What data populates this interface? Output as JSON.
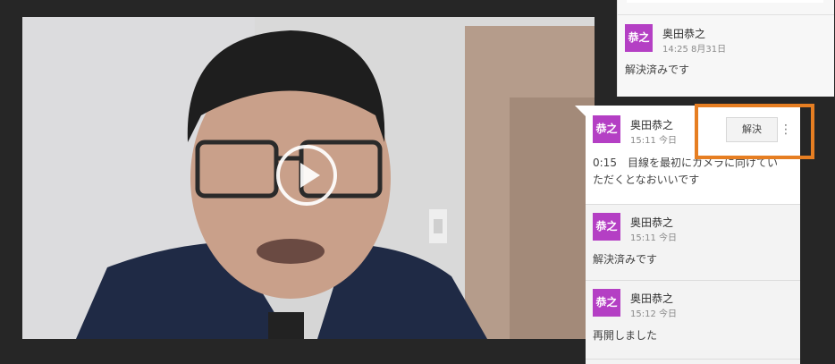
{
  "video": {
    "play_icon": "play-icon"
  },
  "comments_top": {
    "avatar_text": "恭之",
    "author": "奥田恭之",
    "timestamp": "14:25 8月31日",
    "body": "解決済みです"
  },
  "thread": {
    "comments": [
      {
        "avatar_text": "恭之",
        "author": "奥田恭之",
        "timestamp": "15:11 今日",
        "body_line1": "0:15　目線を最初にカメラに向けてい",
        "body_line2": "ただくとなおいいです"
      },
      {
        "avatar_text": "恭之",
        "author": "奥田恭之",
        "timestamp": "15:11 今日",
        "body": "解決済みです"
      },
      {
        "avatar_text": "恭之",
        "author": "奥田恭之",
        "timestamp": "15:12 今日",
        "body": "再開しました"
      }
    ],
    "resolve_label": "解決",
    "more_icon": "⋮"
  },
  "colors": {
    "avatar": "#b43fc4",
    "highlight": "#e67e22",
    "background": "#262626"
  }
}
